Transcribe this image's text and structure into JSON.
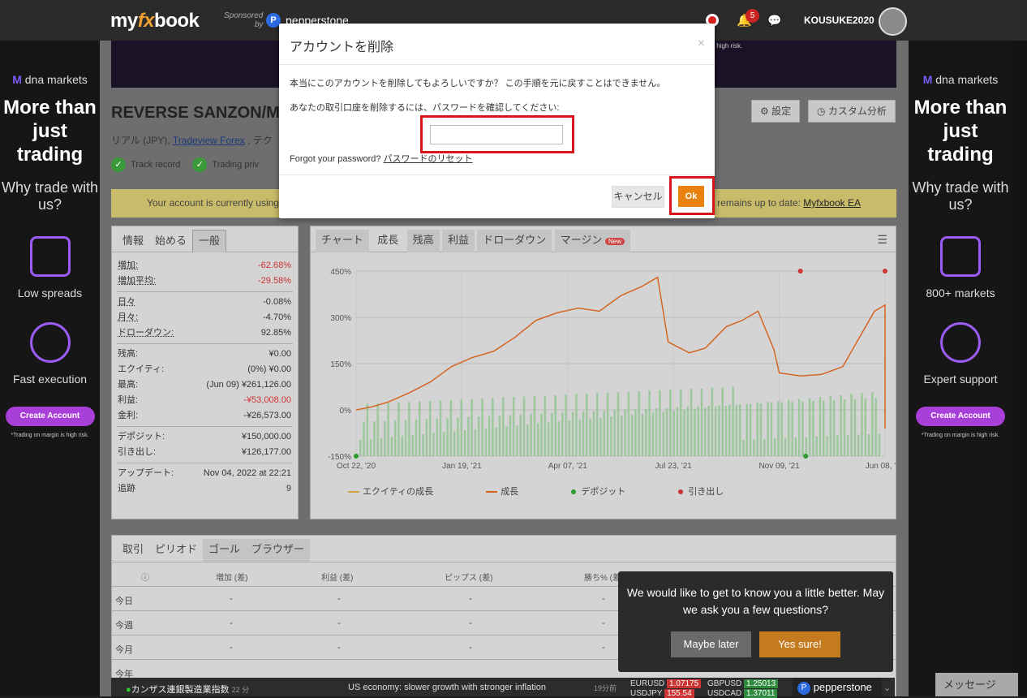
{
  "header": {
    "logo_prefix": "my",
    "logo_fx": "fx",
    "logo_suffix": "book",
    "sponsored_label": "Sponsored\nby",
    "sponsor_name": "pepperstone",
    "notifications_count": "5",
    "username": "KOUSUKE2020",
    "banner_note": "s high risk."
  },
  "sidebar_ad": {
    "brand": "dna markets",
    "headline": "More than just trading",
    "why": "Why trade with us?",
    "left_feature1": "Low spreads",
    "left_feature2": "Fast execution",
    "right_feature1": "800+ markets",
    "right_feature2": "Expert support",
    "cta": "Create Account",
    "fine_print": "*Trading on margin is high risk."
  },
  "account": {
    "title": "REVERSE SANZON/M",
    "subtitle_type": "リアル (JPY), ",
    "broker": "Tradeview Forex",
    "subtitle_rest": " , テク",
    "badge1": "Track record",
    "badge2": "Trading priv",
    "btn_settings": "設定",
    "btn_custom": "カスタム分析",
    "alert_left": "Your account is currently using",
    "alert_right": "t remains up to date: ",
    "alert_link": "Myfxbook EA"
  },
  "stats": {
    "tabs": [
      "情報",
      "始める",
      "一般"
    ],
    "rows": [
      {
        "label": "増加:",
        "value": "-62.68%",
        "neg": true
      },
      {
        "label": "増加平均:",
        "value": "-29.58%",
        "neg": true
      },
      {
        "label": "日々",
        "value": "-0.08%"
      },
      {
        "label": "月々:",
        "value": "-4.70%"
      },
      {
        "label": "ドローダウン:",
        "value": "92.85%"
      },
      {
        "label": "残高:",
        "value": "¥0.00"
      },
      {
        "label": "エクイティ:",
        "value": "(0%) ¥0.00"
      },
      {
        "label": "最高:",
        "value": "(Jun 09) ¥261,126.00"
      },
      {
        "label": "利益:",
        "value": "-¥53,008.00",
        "neg": true
      },
      {
        "label": "金利:",
        "value": "-¥26,573.00"
      },
      {
        "label": "デポジット:",
        "value": "¥150,000.00"
      },
      {
        "label": "引き出し:",
        "value": "¥126,177.00"
      },
      {
        "label": "アップデート:",
        "value": "Nov 04, 2022 at 22:21"
      },
      {
        "label": "追跡",
        "value": "9"
      }
    ]
  },
  "chart_tabs": [
    "チャート",
    "成長",
    "残高",
    "利益",
    "ドローダウン",
    "マージン"
  ],
  "chart_new_badge": "New",
  "chart_data": {
    "type": "line",
    "x_ticks": [
      "Oct 22, '20",
      "Jan 19, '21",
      "Apr 07, '21",
      "Jul 23, '21",
      "Nov 09, '21",
      "Jun 08, '22"
    ],
    "y_ticks": [
      "450%",
      "300%",
      "150%",
      "0%",
      "-150%"
    ],
    "ylim": [
      -150,
      450
    ],
    "series": [
      {
        "name": "エクイティの成長",
        "color": "#d4a040"
      },
      {
        "name": "成長",
        "color": "#d4621f",
        "values": [
          [
            0,
            0
          ],
          [
            0.03,
            10
          ],
          [
            0.06,
            25
          ],
          [
            0.1,
            55
          ],
          [
            0.14,
            90
          ],
          [
            0.18,
            140
          ],
          [
            0.22,
            170
          ],
          [
            0.26,
            190
          ],
          [
            0.3,
            235
          ],
          [
            0.34,
            290
          ],
          [
            0.38,
            315
          ],
          [
            0.42,
            330
          ],
          [
            0.46,
            320
          ],
          [
            0.5,
            370
          ],
          [
            0.54,
            400
          ],
          [
            0.57,
            430
          ],
          [
            0.59,
            220
          ],
          [
            0.63,
            185
          ],
          [
            0.66,
            200
          ],
          [
            0.7,
            270
          ],
          [
            0.73,
            290
          ],
          [
            0.76,
            320
          ],
          [
            0.79,
            195
          ],
          [
            0.8,
            120
          ],
          [
            0.84,
            110
          ],
          [
            0.88,
            115
          ],
          [
            0.92,
            140
          ],
          [
            0.95,
            230
          ],
          [
            0.98,
            320
          ],
          [
            1.0,
            340
          ],
          [
            1.0,
            -60
          ]
        ]
      },
      {
        "name": "デポジット",
        "color": "#2a9a2a"
      },
      {
        "name": "引き出し",
        "color": "#cc3333"
      }
    ]
  },
  "periods": {
    "tabs": [
      "取引",
      "ピリオド",
      "ゴール",
      "ブラウザー"
    ],
    "columns": [
      "増加 (差)",
      "利益 (差)",
      "ピップス (差)",
      "勝ち% (差)"
    ],
    "rows": [
      {
        "label": "今日",
        "vals": [
          "-",
          "-",
          "-",
          "-"
        ]
      },
      {
        "label": "今週",
        "vals": [
          "-",
          "-",
          "-",
          "-"
        ]
      },
      {
        "label": "今月",
        "vals": [
          "-",
          "-",
          "-",
          "-"
        ]
      },
      {
        "label": "今年",
        "vals": [
          "",
          "",
          "",
          ""
        ]
      }
    ]
  },
  "ticker": {
    "event": "カンザス連銀製造業指数",
    "event_time": "22 分",
    "news": "US economy: slower growth with stronger inflation",
    "news_time": "19分前",
    "pairs": [
      {
        "name": "EURUSD",
        "value": "1.07175",
        "dir": "down"
      },
      {
        "name": "GBPUSD",
        "value": "1.25013",
        "dir": "up"
      },
      {
        "name": "USDJPY",
        "value": "155.54",
        "dir": "down"
      },
      {
        "name": "USDCAD",
        "value": "1.37011",
        "dir": "up"
      }
    ],
    "brand": "pepperstone"
  },
  "messages_label": "メッセージ",
  "survey": {
    "question": "We would like to get to know you a little better. May we ask you a few questions?",
    "later": "Maybe later",
    "yes": "Yes sure!"
  },
  "modal": {
    "title": "アカウントを削除",
    "close": "×",
    "warning": "本当にこのアカウントを削除してもよろしいですか？ この手順を元に戻すことはできません。",
    "confirm_prompt": "あなたの取引口座を削除するには、パスワードを確認してください:",
    "password_value": "",
    "forgot_label": "Forgot your password?",
    "reset_link": "パスワードのリセット",
    "cancel": "キャンセル",
    "ok": "Ok"
  }
}
